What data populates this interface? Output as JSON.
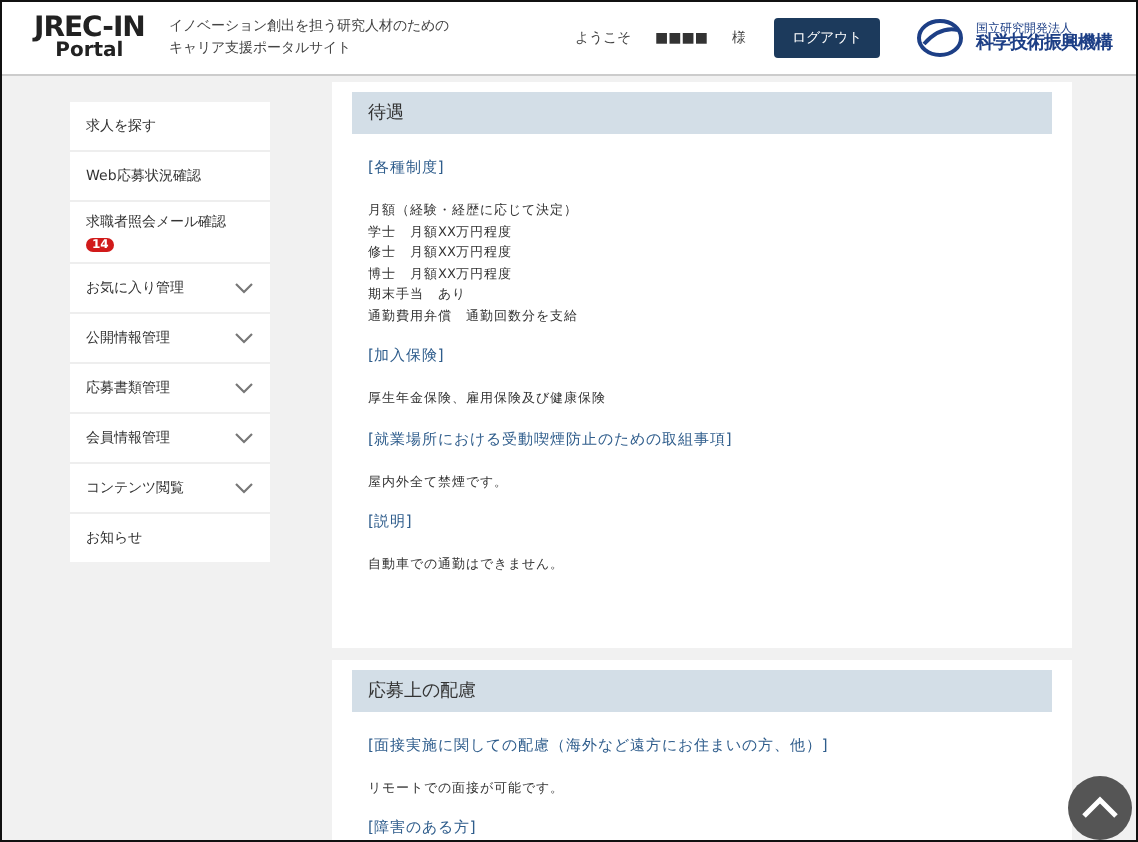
{
  "header": {
    "logo": {
      "main": "JREC-IN",
      "sub": "Portal"
    },
    "tagline": [
      "イノベーション創出を担う研究人材のための",
      "キャリア支援ポータルサイト"
    ],
    "welcome": "ようこそ",
    "user": "■■■■",
    "honorific": "様",
    "logout": "ログアウト",
    "org": {
      "small": "国立研究開発法人",
      "name": "科学技術振興機構"
    }
  },
  "sidebar": {
    "items": [
      {
        "label": "求人を探す",
        "expandable": false
      },
      {
        "label": "Web応募状況確認",
        "expandable": false
      },
      {
        "label": "求職者照会メール確認",
        "expandable": false,
        "badge": "14"
      },
      {
        "label": "お気に入り管理",
        "expandable": true
      },
      {
        "label": "公開情報管理",
        "expandable": true
      },
      {
        "label": "応募書類管理",
        "expandable": true
      },
      {
        "label": "会員情報管理",
        "expandable": true
      },
      {
        "label": "コンテンツ閲覧",
        "expandable": true
      },
      {
        "label": "お知らせ",
        "expandable": false
      }
    ]
  },
  "sections": [
    {
      "title": "待遇",
      "blocks": [
        {
          "heading": "[各種制度]",
          "lines": [
            "月額（経験・経歴に応じて決定）",
            "学士　月額XX万円程度",
            "修士　月額XX万円程度",
            "博士　月額XX万円程度",
            "期末手当　あり",
            "通勤費用弁償　通勤回数分を支給"
          ]
        },
        {
          "heading": "[加入保険]",
          "lines": [
            "厚生年金保険、雇用保険及び健康保険"
          ]
        },
        {
          "heading": "[就業場所における受動喫煙防止のための取組事項]",
          "lines": [
            "屋内外全て禁煙です。"
          ]
        },
        {
          "heading": "[説明]",
          "lines": [
            "自動車での通勤はできません。"
          ]
        }
      ]
    },
    {
      "title": "応募上の配慮",
      "blocks": [
        {
          "heading": "[面接実施に関しての配慮（海外など遠方にお住まいの方、他）]",
          "lines": [
            "リモートでの面接が可能です。"
          ]
        },
        {
          "heading": "[障害のある方]"
        }
      ]
    }
  ]
}
